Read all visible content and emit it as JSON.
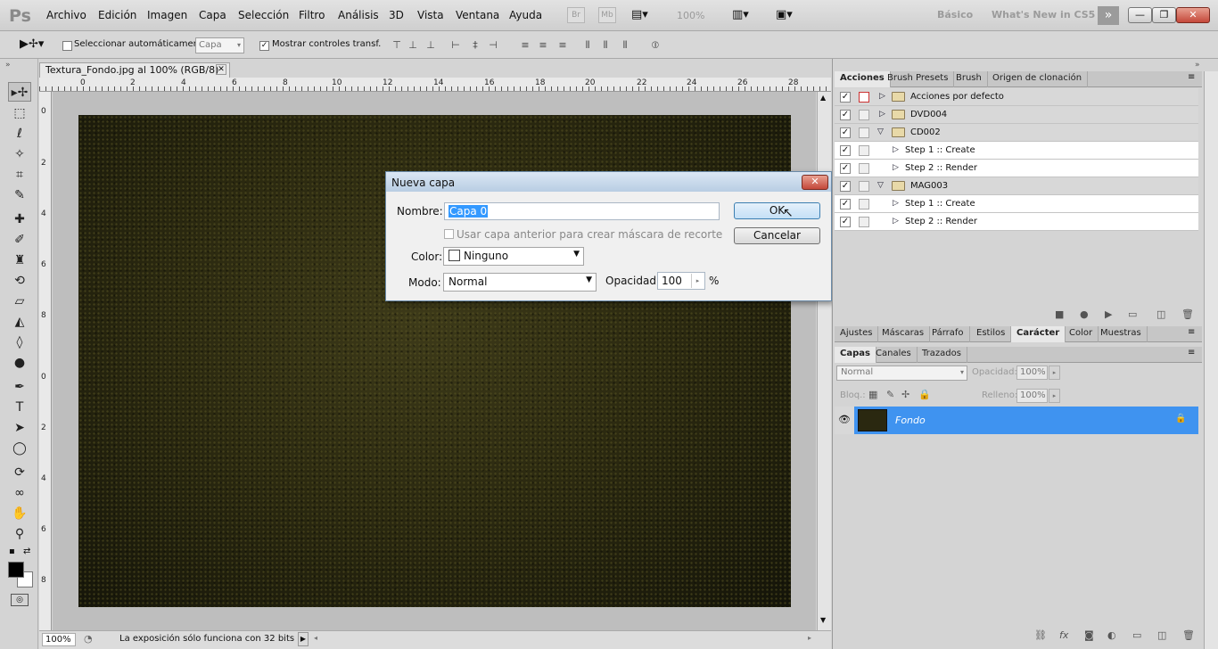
{
  "app": {
    "logo": "Ps"
  },
  "menu": [
    "Archivo",
    "Edición",
    "Imagen",
    "Capa",
    "Selección",
    "Filtro",
    "Análisis",
    "3D",
    "Vista",
    "Ventana",
    "Ayuda"
  ],
  "menubar": {
    "br": "Br",
    "mb": "Mb",
    "zoom": "100%",
    "workspace_basic": "Básico",
    "workspace_new": "What's New in CS5"
  },
  "options": {
    "auto_select_label": "Seleccionar automáticamente:",
    "auto_select_value": "Capa",
    "show_transform_label": "Mostrar controles transf.",
    "show_transform_checked": true
  },
  "document": {
    "tab_title": "Textura_Fondo.jpg al 100% (RGB/8)",
    "ruler_top": [
      "0",
      "2",
      "4",
      "6",
      "8",
      "10",
      "12",
      "14",
      "16",
      "18",
      "20",
      "22",
      "24",
      "26",
      "28"
    ],
    "ruler_left": [
      "0",
      "2",
      "4",
      "6",
      "8",
      "0",
      "2",
      "4",
      "6",
      "8"
    ]
  },
  "status": {
    "zoom": "100%",
    "message": "La exposición sólo funciona con 32 bits"
  },
  "dialog": {
    "title": "Nueva capa",
    "name_label": "Nombre:",
    "name_value": "Capa 0",
    "clip_label": "Usar capa anterior para crear máscara de recorte",
    "color_label": "Color:",
    "color_value": "Ninguno",
    "mode_label": "Modo:",
    "mode_value": "Normal",
    "opacity_label": "Opacidad:",
    "opacity_value": "100",
    "opacity_unit": "%",
    "ok": "OK",
    "cancel": "Cancelar"
  },
  "actions_panel": {
    "tabs": [
      "Acciones",
      "Brush Presets",
      "Brush",
      "Origen de clonación"
    ],
    "rows": [
      {
        "label": "Acciones por defecto",
        "type": "group",
        "expanded": false
      },
      {
        "label": "DVD004",
        "type": "group",
        "expanded": false
      },
      {
        "label": "CD002",
        "type": "group",
        "expanded": true
      },
      {
        "label": "Step 1 :: Create",
        "type": "step"
      },
      {
        "label": "Step 2 :: Render",
        "type": "step"
      },
      {
        "label": "MAG003",
        "type": "group",
        "expanded": true
      },
      {
        "label": "Step 1 :: Create",
        "type": "step"
      },
      {
        "label": "Step 2 :: Render",
        "type": "step"
      }
    ]
  },
  "adjust_tabs": [
    "Ajustes",
    "Máscaras",
    "Párrafo",
    "Estilos",
    "Carácter",
    "Color",
    "Muestras"
  ],
  "layers_panel": {
    "tabs": [
      "Capas",
      "Canales",
      "Trazados"
    ],
    "blend": "Normal",
    "opacity_label": "Opacidad:",
    "opacity_value": "100%",
    "lock_label": "Bloq.:",
    "fill_label": "Relleno:",
    "fill_value": "100%",
    "layer_name": "Fondo"
  },
  "colors": {
    "accent": "#3f93f0",
    "selection": "#3399ff"
  }
}
